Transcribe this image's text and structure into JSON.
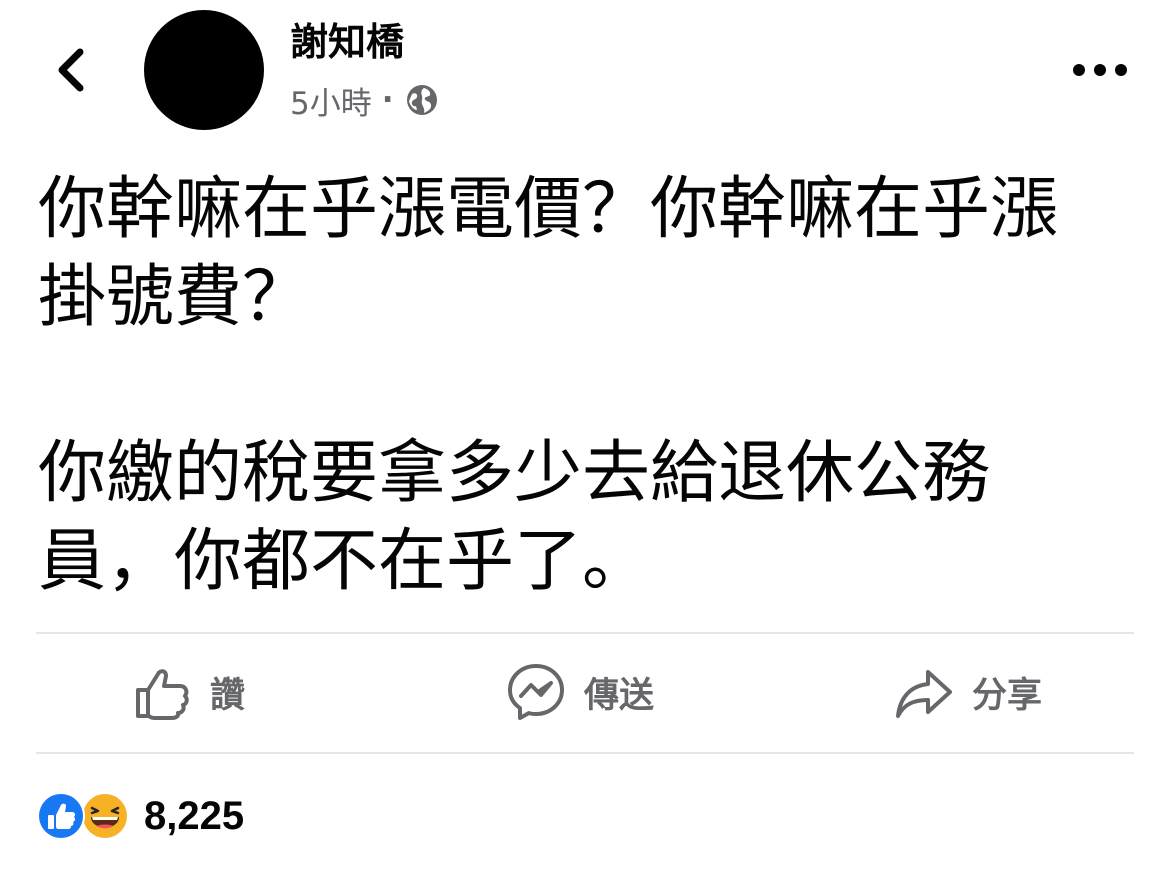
{
  "header": {
    "author_name": "謝知橋",
    "timestamp": "5小時",
    "separator": "·",
    "icons": {
      "back": "chevron-left-icon",
      "privacy": "globe-icon",
      "more": "more-horizontal-icon"
    }
  },
  "post": {
    "paragraph_1": "你幹嘛在乎漲電價？你幹嘛在乎漲\n掛號費？",
    "paragraph_2": "你繳的稅要拿多少去給退休公務\n員，你都不在乎了。"
  },
  "actions": {
    "like_label": "讚",
    "send_label": "傳送",
    "share_label": "分享"
  },
  "reactions": {
    "count": "8,225",
    "types": [
      "like",
      "haha"
    ]
  },
  "colors": {
    "secondary_text": "#65676b",
    "divider": "#e4e6eb",
    "like_blue": "#1877f2",
    "haha_yellow": "#f7b125"
  }
}
